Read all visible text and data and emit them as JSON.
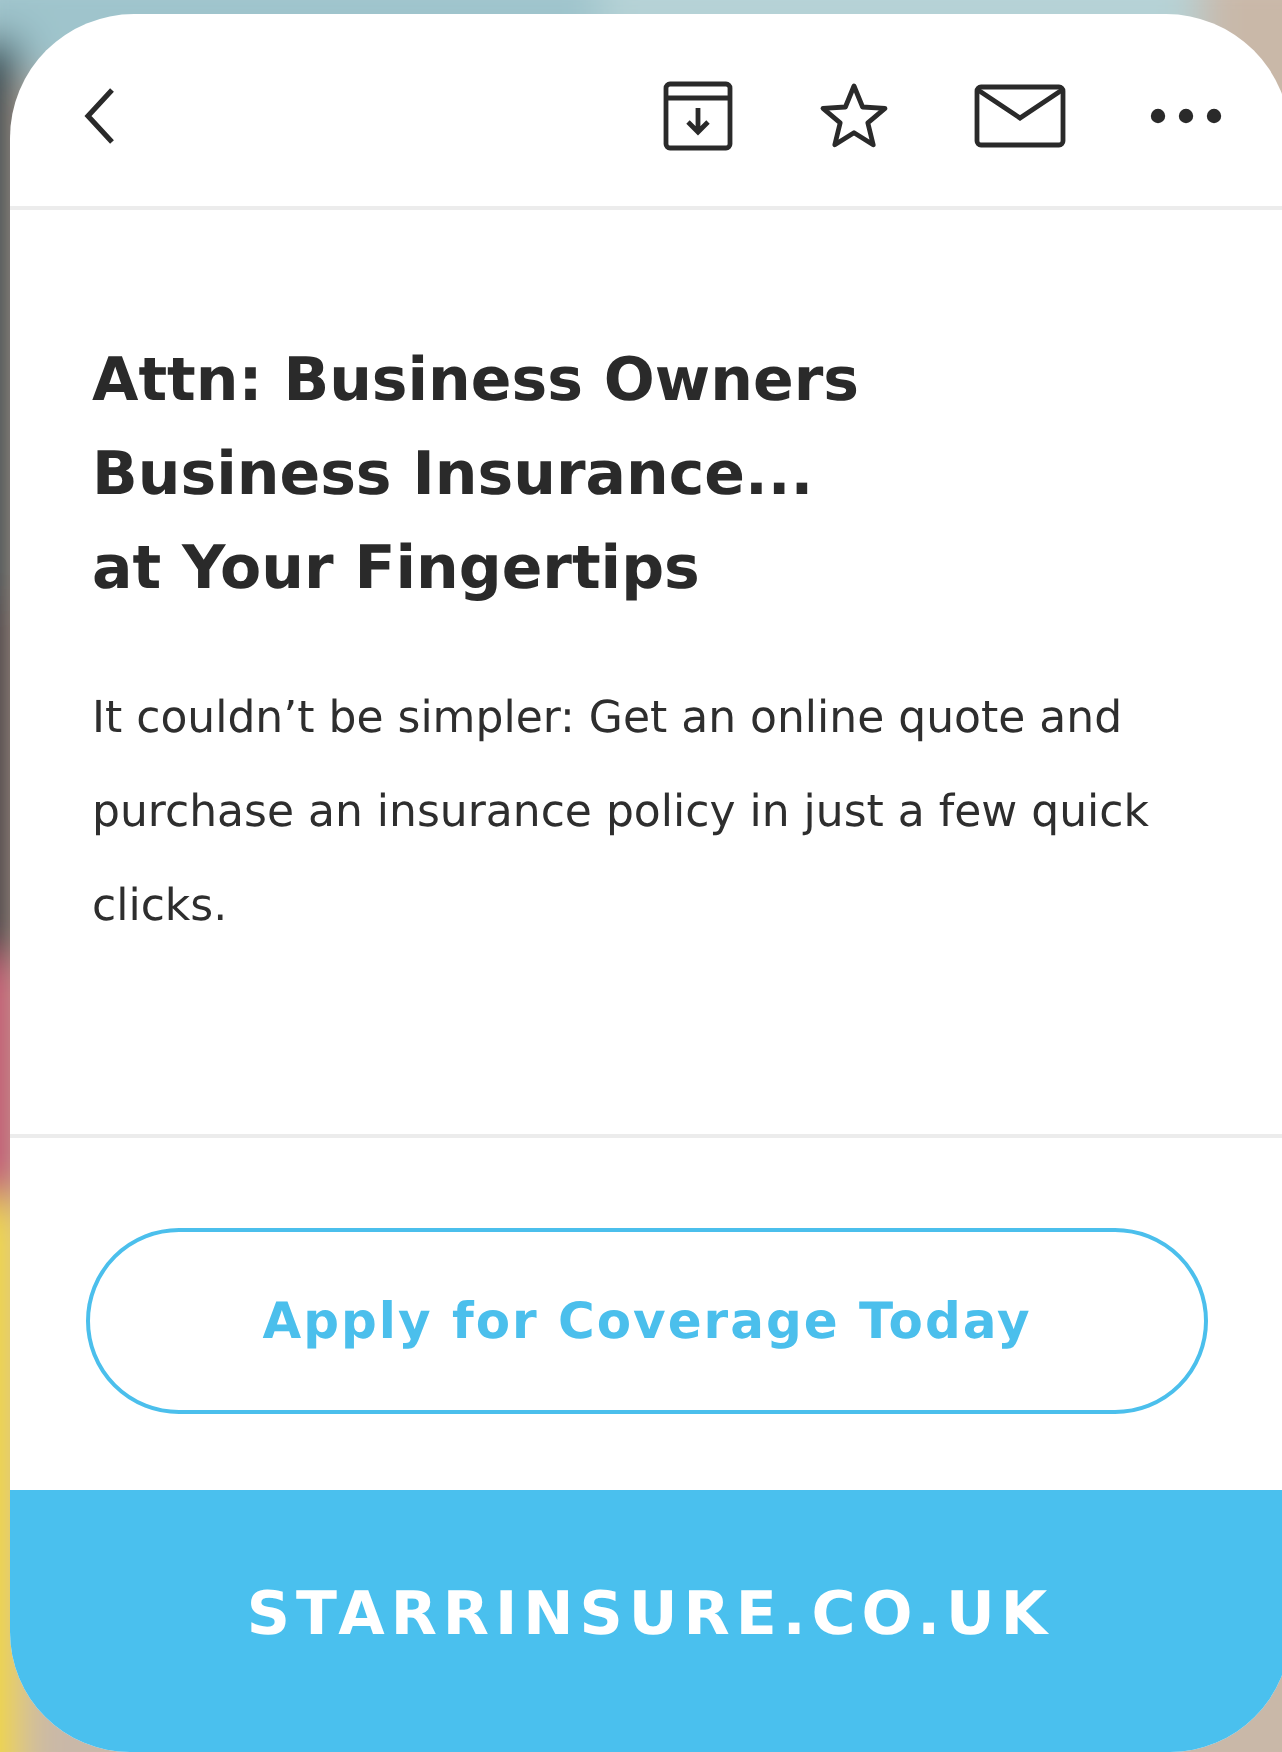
{
  "message": {
    "title_lines": [
      "Attn: Business Owners",
      "Business Insurance...",
      "at Your Fingertips"
    ],
    "body": "It couldn’t be simpler: Get an online quote and purchase an insurance policy in just a few quick clicks.",
    "cta_button": "Apply for Coverage Today",
    "footer_link": "STARRINSURE.CO.UK"
  }
}
